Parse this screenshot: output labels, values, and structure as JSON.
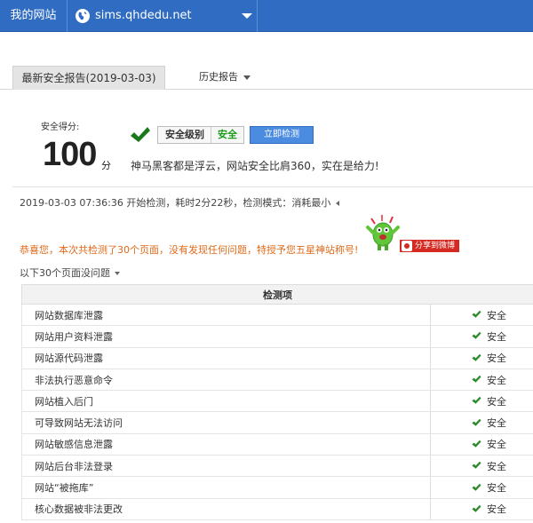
{
  "topbar": {
    "site_label": "我的网站",
    "site_url": "sims.qhdedu.net"
  },
  "tabs": {
    "latest": "最新安全报告(2019-03-03)",
    "history": "历史报告"
  },
  "score": {
    "label": "安全得分:",
    "value": "100",
    "unit": "分",
    "badge_label": "安全级别",
    "badge_value": "安全",
    "scan_button": "立即检测",
    "slogan": "神马黑客都是浮云，网站安全比肩360，实在是给力!"
  },
  "scan_info": "2019-03-03 07:36:36 开始检测，耗时2分22秒，检测模式：消耗最小",
  "congrats": "恭喜您，本次共检测了30个页面，没有发现任何问题，特授予您五星神站称号!",
  "share_button": "分享到微博",
  "section_title": "以下30个页面没问题",
  "table": {
    "header": "检测项",
    "rows": [
      {
        "name": "网站数据库泄露",
        "result": "安全"
      },
      {
        "name": "网站用户资料泄露",
        "result": "安全"
      },
      {
        "name": "网站源代码泄露",
        "result": "安全"
      },
      {
        "name": "非法执行恶意命令",
        "result": "安全"
      },
      {
        "name": "网站植入后门",
        "result": "安全"
      },
      {
        "name": "可导致网站无法访问",
        "result": "安全"
      },
      {
        "name": "网站敏感信息泄露",
        "result": "安全"
      },
      {
        "name": "网站后台非法登录",
        "result": "安全"
      },
      {
        "name": "网站“被拖库”",
        "result": "安全"
      },
      {
        "name": "核心数据被非法更改",
        "result": "安全"
      }
    ]
  },
  "colors": {
    "topbar": "#2f6cc2",
    "safe_green": "#1a9a1a",
    "congrats_orange": "#e06a1a",
    "share_red": "#d42a22"
  }
}
